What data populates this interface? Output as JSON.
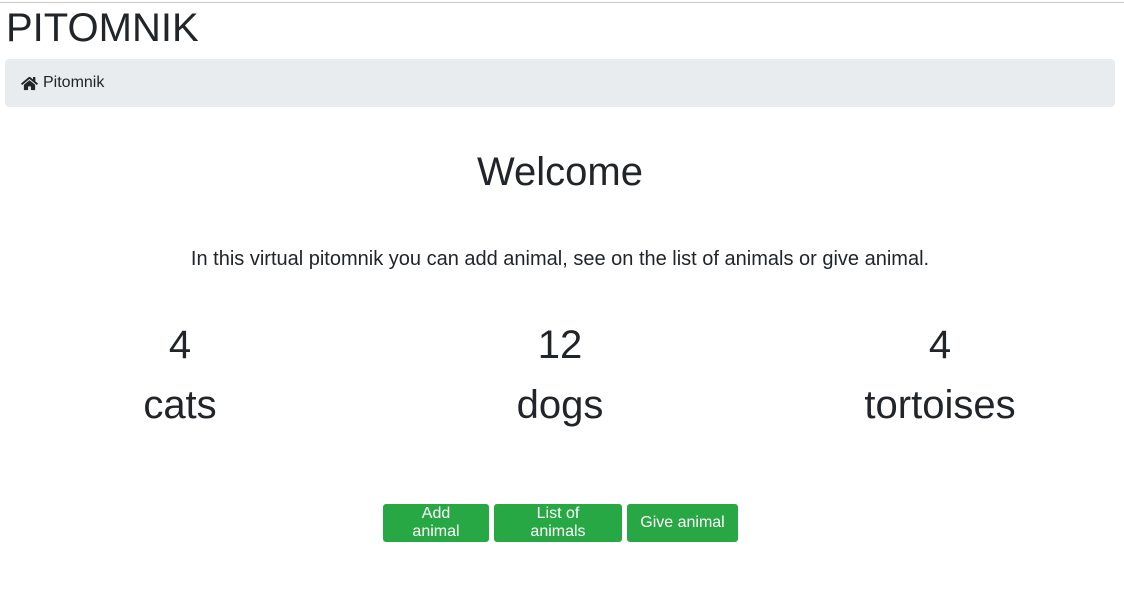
{
  "header": {
    "title": "PITOMNIK"
  },
  "breadcrumb": {
    "home_label": "Pitomnik",
    "icon": "home-icon"
  },
  "main": {
    "heading": "Welcome",
    "intro": "In this virtual pitomnik you can add animal, see on the list of animals or give animal.",
    "stats": [
      {
        "count": "4",
        "label": "cats"
      },
      {
        "count": "12",
        "label": "dogs"
      },
      {
        "count": "4",
        "label": "tortoises"
      }
    ],
    "actions": {
      "add_label": "Add animal",
      "list_label": "List of animals",
      "give_label": "Give animal"
    }
  },
  "colors": {
    "button_bg": "#28a745",
    "breadcrumb_bg": "#e9ecef",
    "text": "#212529"
  }
}
